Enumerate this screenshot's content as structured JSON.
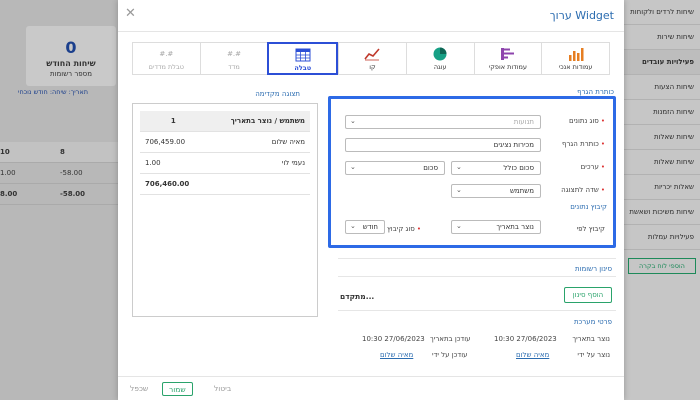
{
  "background": {
    "card": {
      "count": "0",
      "title": "שיחות החודש",
      "subtitle": "מספר רשומות",
      "link": "תאריך: שיחה: חודש נוכחי"
    },
    "table": {
      "header": [
        "10",
        "8"
      ],
      "rows": [
        [
          "1.00",
          "-58.00"
        ],
        [
          "8.00",
          "-58.00"
        ]
      ]
    },
    "sidebar": [
      {
        "label": "שיחות לרדים ולקוחות",
        "active": false
      },
      {
        "label": "שיחות שירות",
        "active": false
      },
      {
        "label": "פעילויות עובדים",
        "active": true
      },
      {
        "label": "שיחות הצעות",
        "active": false
      },
      {
        "label": "שיחות הזמנות",
        "active": false
      },
      {
        "label": "שיחות שאלות",
        "active": false
      },
      {
        "label": "שיחות שאלות",
        "active": false
      },
      {
        "label": "שאלות יכריות",
        "active": false
      },
      {
        "label": "שיחות משיכות ושאשת",
        "active": false
      },
      {
        "label": "פעילויות עמלות",
        "active": false
      }
    ],
    "add_view": "הוספי לוח בקרה"
  },
  "modal": {
    "title": "ערוך Widget",
    "widget_types": [
      {
        "label": "עמודות אנכי",
        "icon": "vertical-bars-icon",
        "selected": false,
        "disabled": false,
        "color": "#e67e22"
      },
      {
        "label": "עמודות אופקי",
        "icon": "horizontal-bars-icon",
        "selected": false,
        "disabled": false,
        "color": "#8e44ad"
      },
      {
        "label": "עוגה",
        "icon": "pie-icon",
        "selected": false,
        "disabled": false,
        "color": "#16a085"
      },
      {
        "label": "קו",
        "icon": "line-icon",
        "selected": false,
        "disabled": false,
        "color": "#c0392b"
      },
      {
        "label": "טבלה",
        "icon": "table-icon",
        "selected": true,
        "disabled": false,
        "color": "#2c4fd6"
      },
      {
        "label": "מדד",
        "icon": "gauge-icon",
        "selected": false,
        "disabled": true,
        "color": "#aaaaaa",
        "top": "#.#"
      },
      {
        "label": "טבלת מדדים",
        "icon": "gauge-table-icon",
        "selected": false,
        "disabled": true,
        "color": "#aaaaaa",
        "top": "#.#"
      }
    ],
    "preview": {
      "label": "תצוגה מקדימה",
      "header": [
        "משתמש / נוצר בתאריך",
        "1"
      ],
      "rows": [
        [
          "מאיה שלום",
          "706,459.00"
        ],
        [
          "נעמי לוי",
          "1.00"
        ]
      ],
      "total": "706,460.00"
    },
    "form": {
      "section_title": "כותרת הגרף",
      "data_source_label": "סוג נתונים",
      "data_source_value": "תנועות",
      "chart_title_label": "כותרת הגרף",
      "chart_title_value": "מכירות נציגים",
      "values_label": "ערכים",
      "values_agg": "סכום כולל",
      "values_field": "סכום",
      "display_field_label": "שדה לתצוגה",
      "display_field_value": "משתמש",
      "grouping_title": "קיבוץ נתונים",
      "group_by_label": "קיבוץ לפי",
      "group_by_value": "נוצר בתאריך",
      "group_type_label": "סוג קיבוץ",
      "group_type_value": "חודש"
    },
    "filter": {
      "title": "סינון רשומות",
      "add_button": "הוסף סינון",
      "advanced": "מתקדם..."
    },
    "system": {
      "title": "פרטי מערכת",
      "created_label": "נוצר בתאריך",
      "created_value": "10:30 27/06/2023",
      "updated_label": "עודכן בתאריך",
      "updated_value": "10:30 27/06/2023",
      "created_by_label": "נוצר על ידי",
      "created_by_value": "מאיה שלום",
      "updated_by_label": "עודכן על ידי",
      "updated_by_value": "מאיה שלום"
    },
    "footer": {
      "save": "שמור",
      "duplicate": "שכפל",
      "cancel": "ביטול"
    }
  }
}
